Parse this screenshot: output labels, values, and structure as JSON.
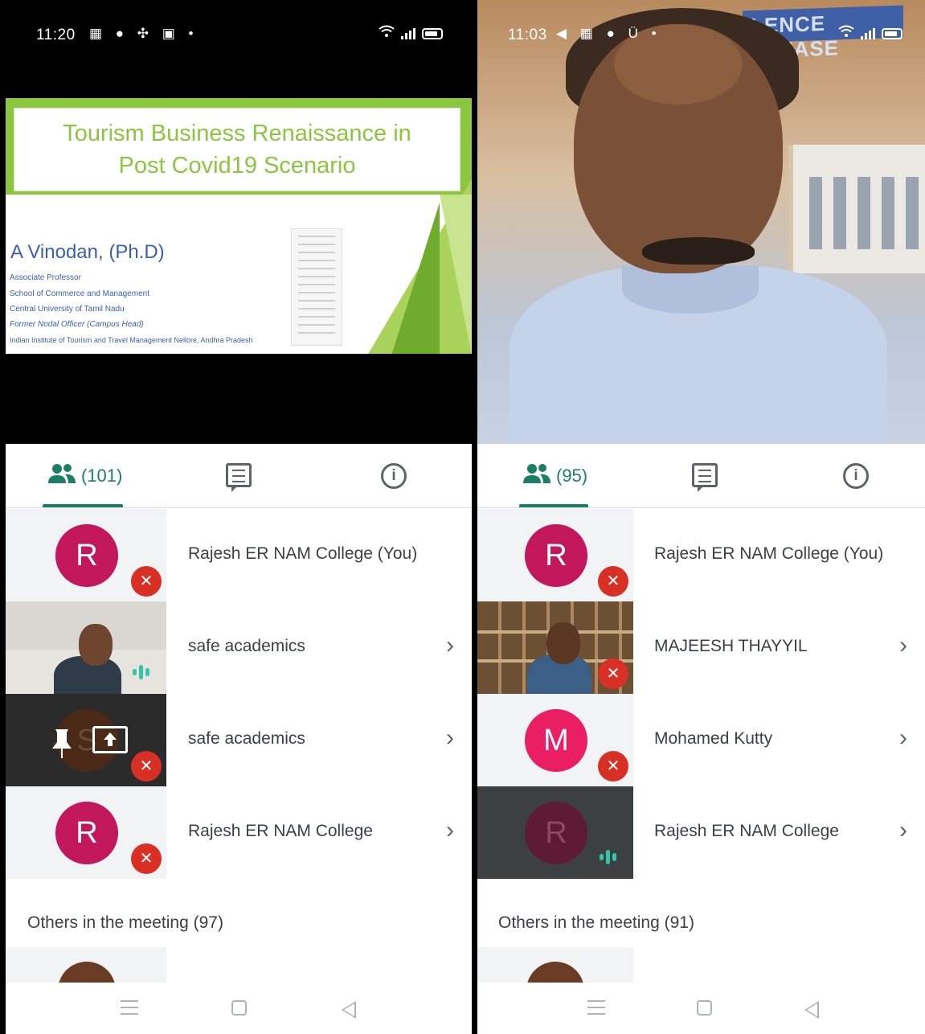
{
  "left": {
    "status": {
      "time": "11:20",
      "icons": "▦ ● ✣ ▣ •"
    },
    "slide": {
      "title": "Tourism Business Renaissance in Post Covid19 Scenario",
      "author": "A Vinodan, (Ph.D)",
      "affiliations": [
        "Associate Professor",
        "School of Commerce and Management",
        "Central University of Tamil Nadu",
        "Former Nodal Officer (Campus Head)",
        "Indian Institute of Tourism and Travel Management Nellore, Andhra Pradesh"
      ]
    },
    "tabs": {
      "people_count": "(101)"
    },
    "participants": [
      {
        "name": "Rajesh ER NAM College (You)",
        "initial": "R",
        "avatar_color": "#c2185b",
        "state": "muted"
      },
      {
        "name": "safe academics",
        "state": "talking"
      },
      {
        "name": "safe academics",
        "initial": "S",
        "state": "muted"
      },
      {
        "name": "Rajesh ER NAM College",
        "initial": "R",
        "avatar_color": "#c2185b",
        "state": "muted"
      }
    ],
    "others_label": "Others in the meeting (97)"
  },
  "right": {
    "status": {
      "time": "11:03",
      "icons": "◀ ▦ ● Ü •"
    },
    "banner_text": "LENCE PLEASE",
    "tabs": {
      "people_count": "(95)"
    },
    "participants": [
      {
        "name": "Rajesh ER NAM College (You)",
        "initial": "R",
        "avatar_color": "#c2185b",
        "state": "muted"
      },
      {
        "name": "MAJEESH THAYYIL",
        "state": "muted"
      },
      {
        "name": "Mohamed Kutty",
        "initial": "M",
        "avatar_color": "#e91e63",
        "state": "muted"
      },
      {
        "name": "Rajesh ER NAM College",
        "initial": "R",
        "avatar_color": "#5c1a33",
        "state": "talking"
      }
    ],
    "others_label": "Others in the meeting (91)"
  },
  "colors": {
    "accent": "#1a7f64",
    "mute": "#d93025",
    "talking": "#35c4a6",
    "slide_green": "#8cc63f"
  }
}
